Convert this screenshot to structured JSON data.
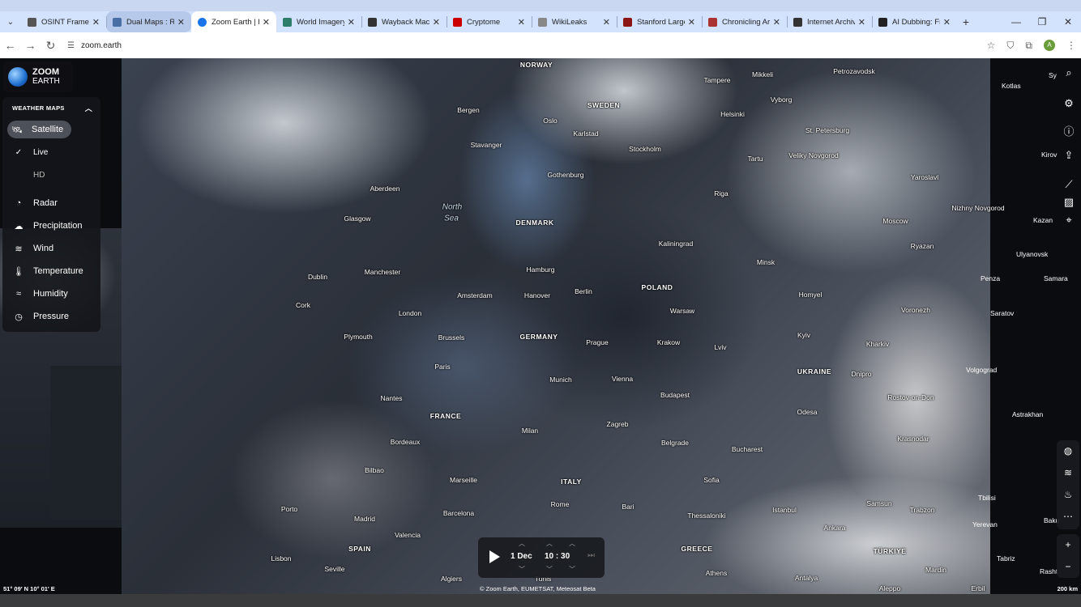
{
  "browser": {
    "tabs": [
      {
        "title": "OSINT Framew",
        "icon_color": "#5f6368"
      },
      {
        "title": "Dual Maps : Re",
        "icon_color": "#4a6fa5"
      },
      {
        "title": "Zoom Earth | L",
        "icon_color": "#1a73e8"
      },
      {
        "title": "World Imagery",
        "icon_color": "#2e7d6b"
      },
      {
        "title": "Wayback Mach",
        "icon_color": "#333333"
      },
      {
        "title": "Cryptome",
        "icon_color": "#cc0000"
      },
      {
        "title": "WikiLeaks",
        "icon_color": "#888888"
      },
      {
        "title": "Stanford Large",
        "icon_color": "#8c1515"
      },
      {
        "title": "Chronicling Ar",
        "icon_color": "#a33"
      },
      {
        "title": "Internet Archiv",
        "icon_color": "#333333"
      },
      {
        "title": "AI Dubbing: Fr",
        "icon_color": "#222222"
      }
    ],
    "active_tab": 2,
    "url": "zoom.earth",
    "profile_initial": "A"
  },
  "logo": {
    "line1": "ZOOM",
    "line2": "EARTH"
  },
  "panel": {
    "header": "WEATHER MAPS",
    "items": {
      "satellite": "Satellite",
      "live": "Live",
      "hd": "HD",
      "radar": "Radar",
      "precipitation": "Precipitation",
      "wind": "Wind",
      "temperature": "Temperature",
      "humidity": "Humidity",
      "pressure": "Pressure"
    }
  },
  "player": {
    "date": "1 Dec",
    "hour": "10",
    "minute": "30",
    "separator": ":"
  },
  "map": {
    "coords": "51° 09′ N   10° 01′ E",
    "copyright": "© Zoom Earth, EUMETSAT, Meteosat Beta",
    "scale": "200 km",
    "labels": {
      "norway": "NORWAY",
      "sweden": "SWEDEN",
      "denmark": "DENMARK",
      "poland": "POLAND",
      "germany": "GERMANY",
      "france": "FRANCE",
      "ukraine": "UKRAINE",
      "italy": "ITALY",
      "spain": "SPAIN",
      "greece": "GREECE",
      "turkiye": "TÜRKIYE",
      "north": "North",
      "sea": "Sea",
      "tampere": "Tampere",
      "mikkeli": "Mikkeli",
      "petrozavodsk": "Petrozavodsk",
      "bergen": "Bergen",
      "oslo": "Oslo",
      "karlstad": "Karlstad",
      "helsinki": "Helsinki",
      "vyborg": "Vyborg",
      "stpetersburg": "St. Petersburg",
      "stavanger": "Stavanger",
      "stockholm": "Stockholm",
      "tartu": "Tartu",
      "velikynovgorod": "Veliky Novgorod",
      "gothenburg": "Gothenburg",
      "yaroslavl": "Yaroslavl",
      "aberdeen": "Aberdeen",
      "riga": "Riga",
      "nizhnynovgorod": "Nizhny Novgorod",
      "glasgow": "Glasgow",
      "moscow": "Moscow",
      "kaliningrad": "Kaliningrad",
      "ryazan": "Ryazan",
      "dublin": "Dublin",
      "manchester": "Manchester",
      "hamburg": "Hamburg",
      "minsk": "Minsk",
      "berlin": "Berlin",
      "amsterdam": "Amsterdam",
      "hanover": "Hanover",
      "homyel": "Homyel",
      "cork": "Cork",
      "london": "London",
      "warsaw": "Warsaw",
      "voronezh": "Voronezh",
      "plymouth": "Plymouth",
      "brussels": "Brussels",
      "kyiv": "Kyiv",
      "prague": "Prague",
      "krakow": "Krakow",
      "kharkiv": "Kharkiv",
      "lviv": "Lviv",
      "paris": "Paris",
      "dnipro": "Dnipro",
      "munich": "Munich",
      "vienna": "Vienna",
      "nantes": "Nantes",
      "budapest": "Budapest",
      "rostov": "Rostov-on-Don",
      "zagreb": "Zagreb",
      "odesa": "Odesa",
      "bordeaux": "Bordeaux",
      "milan": "Milan",
      "belgrade": "Belgrade",
      "bucharest": "Bucharest",
      "krasnodar": "Krasnodar",
      "bilbao": "Bilbao",
      "marseille": "Marseille",
      "sofia": "Sofia",
      "barcelona": "Barcelona",
      "porto": "Porto",
      "rome": "Rome",
      "bari": "Bari",
      "samsun": "Samsun",
      "trabzon": "Trabzon",
      "madrid": "Madrid",
      "thessaloniki": "Thessaloniki",
      "istanbul": "Istanbul",
      "ankara": "Ankara",
      "valencia": "Valencia",
      "lisbon": "Lisbon",
      "seville": "Seville",
      "algiers": "Algiers",
      "tunis": "Tunis",
      "athens": "Athens",
      "antalya": "Antalya",
      "aleppo": "Aleppo",
      "mardin": "Mardin",
      "erbil": "Erbil"
    },
    "side_labels": {
      "kotlas": "Kotlas",
      "sy": "Sy",
      "kirov": "Kirov",
      "kazan": "Kazan",
      "ulyanovsk": "Ulyanovsk",
      "penza": "Penza",
      "samara": "Samara",
      "saratov": "Saratov",
      "volgograd": "Volgograd",
      "astrakhan": "Astrakhan",
      "tbilisi": "Tbilisi",
      "baku": "Baku",
      "yerevan": "Yerevan",
      "tabriz": "Tabriz",
      "rasht": "Rasht"
    }
  }
}
